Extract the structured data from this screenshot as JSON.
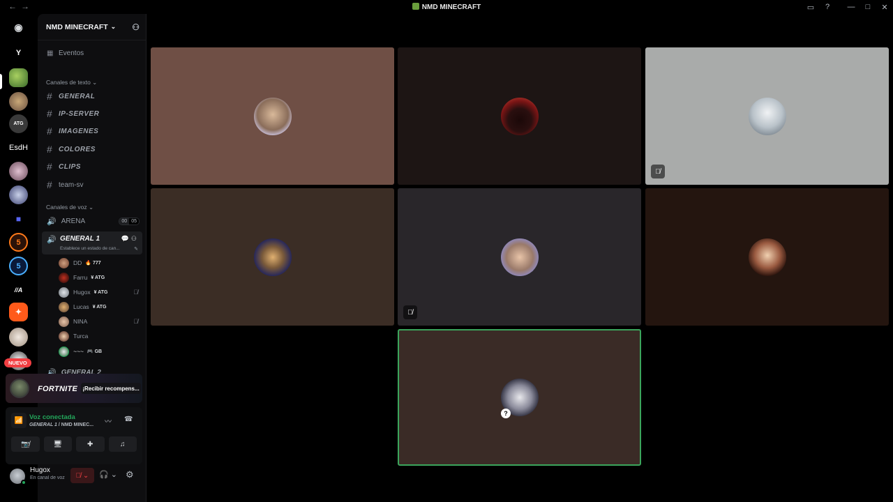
{
  "window": {
    "title": "NMD MINECRAFT"
  },
  "server": {
    "name": "NMD MINECRAFT"
  },
  "guilds": [
    {
      "label": "",
      "name": "discord-home"
    },
    {
      "label": "Y",
      "name": "server-y"
    },
    {
      "label": "",
      "name": "server-green"
    },
    {
      "label": "",
      "name": "server-yellow"
    },
    {
      "label": "",
      "name": "server-atg"
    },
    {
      "label": "EsdH",
      "name": "server-esdh"
    },
    {
      "label": "",
      "name": "server-cat"
    },
    {
      "label": "",
      "name": "server-anime"
    },
    {
      "label": "",
      "name": "folder"
    },
    {
      "label": "5",
      "name": "server-5-orange"
    },
    {
      "label": "5",
      "name": "server-5-blue"
    },
    {
      "label": "",
      "name": "server-logo"
    },
    {
      "label": "",
      "name": "server-orange"
    },
    {
      "label": "",
      "name": "server-cat2"
    },
    {
      "label": "",
      "name": "server-penguin"
    }
  ],
  "sidebar": {
    "events": "Eventos",
    "text_category": "Canales de texto",
    "text_channels": [
      "GENERAL",
      "IP-SERVER",
      "IMAGENES",
      "COLORES",
      "CLIPS",
      "team-sv"
    ],
    "voice_category": "Canales de voz",
    "arena": {
      "name": "ARENA",
      "count_a": "00",
      "count_b": "05"
    },
    "active": {
      "name": "GENERAL 1",
      "status": "Establece un estado de can..."
    },
    "users": [
      {
        "name": "DD",
        "tag": "🔥 777",
        "muted": false
      },
      {
        "name": "Farru",
        "tag": "¥ ATG",
        "muted": false
      },
      {
        "name": "Hugox",
        "tag": "¥ ATG",
        "muted": true
      },
      {
        "name": "Lucas",
        "tag": "¥ ATG",
        "muted": false
      },
      {
        "name": "NINA",
        "tag": "",
        "muted": true
      },
      {
        "name": "Turca",
        "tag": "",
        "muted": false
      },
      {
        "name": "~~~",
        "tag": "🎮 GB",
        "muted": false
      }
    ],
    "general2": "GENERAL 2"
  },
  "badge": {
    "new": "NUEVO"
  },
  "promo": {
    "brand": "FORTNITE",
    "cta": "¡Recibir recompens..."
  },
  "voice_panel": {
    "status": "Voz conectada",
    "channel": "GENERAL 1",
    "server": " / NMD MINEC..."
  },
  "user": {
    "name": "Hugox",
    "status": "En canal de voz"
  },
  "tiles": [
    {
      "bg": "#6f4f45",
      "avatar_bg": "radial-gradient(circle at 50% 45%, #d9b99a 0%, #8a6d5a 55%, #cfc8e8 78%, #7f6fa8 100%)",
      "muted": false,
      "speaking": false
    },
    {
      "bg": "#1d1514",
      "avatar_bg": "radial-gradient(circle at 50% 60%, #1b0808 0%, #2a0f0f 40%, #7a1515 65%, #d14b3a 100%)",
      "muted": false,
      "speaking": false
    },
    {
      "bg": "#a9abaa",
      "avatar_bg": "radial-gradient(circle at 50% 40%, #f0f2f4 0%, #b9c2c9 50%, #5b6670 100%)",
      "muted": true,
      "speaking": false
    },
    {
      "bg": "#3b2d25",
      "avatar_bg": "radial-gradient(circle at 50% 50%, #e0b070 0%, #7a5a3a 40%, #28285a 70%, #6060c0 100%)",
      "muted": false,
      "speaking": false
    },
    {
      "bg": "#29262a",
      "avatar_bg": "radial-gradient(circle at 50% 50%, #e8c4a8 0%, #9a7a6a 50%, #8d8cd0 78%, #4e4a9a 100%)",
      "muted": true,
      "speaking": false
    },
    {
      "bg": "#24150f",
      "avatar_bg": "radial-gradient(circle at 50% 45%, #f0d0b0 0%, #9a5a40 45%, #2a120c 75%, #5a3020 100%)",
      "muted": false,
      "speaking": false
    },
    {
      "bg": "#3a2b26",
      "avatar_bg": "radial-gradient(circle at 50% 50%, #e8e8ec 0%, #8a8a9a 45%, #2a2a3a 75%, #2a6ad0 100%)",
      "muted": false,
      "speaking": true
    }
  ]
}
